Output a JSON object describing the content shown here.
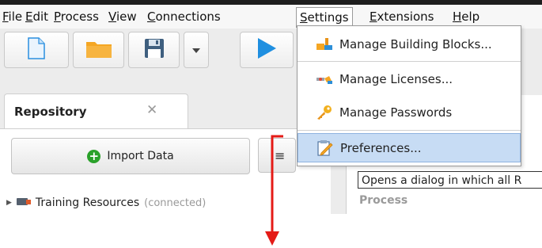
{
  "menubar": {
    "items": [
      "File",
      "Edit",
      "Process",
      "View",
      "Connections",
      "Settings",
      "Extensions",
      "Help"
    ]
  },
  "dropdown": {
    "items": [
      {
        "label": "Manage Building Blocks...",
        "icon": "building-blocks-icon"
      },
      {
        "label": "Manage Licenses...",
        "icon": "licenses-icon"
      },
      {
        "label": "Manage Passwords",
        "icon": "key-icon"
      },
      {
        "label": "Preferences...",
        "icon": "preferences-icon"
      }
    ]
  },
  "tooltip": {
    "text": "Opens a dialog in which all R"
  },
  "repository": {
    "title": "Repository",
    "close": "✕",
    "import_label": "Import Data",
    "menu_glyph": "≡",
    "tree": {
      "name": "Training Resources",
      "status": "(connected)"
    }
  },
  "process_panel": {
    "label": "Process"
  },
  "colors": {
    "accent": "#1f8fe0",
    "folder": "#f5a623",
    "highlight": "#c7dcf4",
    "annotation_arrow": "#e41b17",
    "add_button": "#2aa12a"
  }
}
